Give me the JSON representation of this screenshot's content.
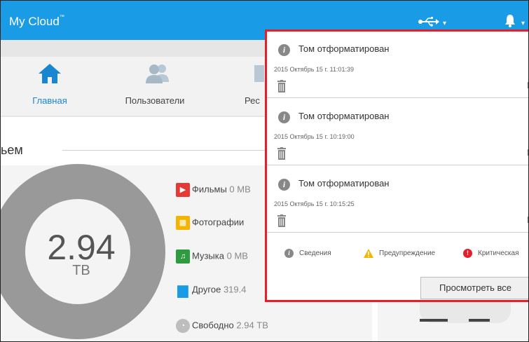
{
  "app": {
    "title": "My Cloud",
    "trademark": "™"
  },
  "header": {
    "usb_icon": "usb-icon",
    "bell_icon": "bell-icon"
  },
  "nav": {
    "items": [
      {
        "label": "Главная",
        "icon": "home-icon",
        "active": true
      },
      {
        "label": "Пользователи",
        "icon": "users-icon"
      },
      {
        "label": "Рес",
        "icon": "backups-icon"
      }
    ]
  },
  "storage": {
    "section_title": "ьем",
    "value": "2.94",
    "unit": "TB",
    "legend": [
      {
        "label": "Фильмы",
        "value": "0 MB",
        "color": "#e53935",
        "icon": "film-icon"
      },
      {
        "label": "Фотографии",
        "value": "",
        "color": "#f5b400",
        "icon": "photo-icon"
      },
      {
        "label": "Музыка",
        "value": "0 MB",
        "color": "#2e9b3f",
        "icon": "music-icon"
      },
      {
        "label": "Другое",
        "value": "319.4",
        "color": "#1a9be6",
        "icon": "document-icon"
      },
      {
        "label": "Свободно",
        "value": "2.94 TB",
        "color": "#bdbdbd",
        "icon": "free-space-icon"
      }
    ]
  },
  "notifications": {
    "items": [
      {
        "title": "Том отформатирован",
        "date": "2015 Октябрь 15 г. 11:01:39"
      },
      {
        "title": "Том отформатирован",
        "date": "2015 Октябрь 15 г. 10:19:00"
      },
      {
        "title": "Том отформатирован",
        "date": "2015 Октябрь 15 г. 10:15:25"
      }
    ],
    "legend": {
      "info": "Сведения",
      "warning": "Предупреждение",
      "critical": "Критическая"
    },
    "view_all": "Просмотреть все",
    "colors": {
      "info": "#888888",
      "warning": "#f5b400",
      "critical": "#e3202a",
      "border": "#e3202a"
    }
  }
}
